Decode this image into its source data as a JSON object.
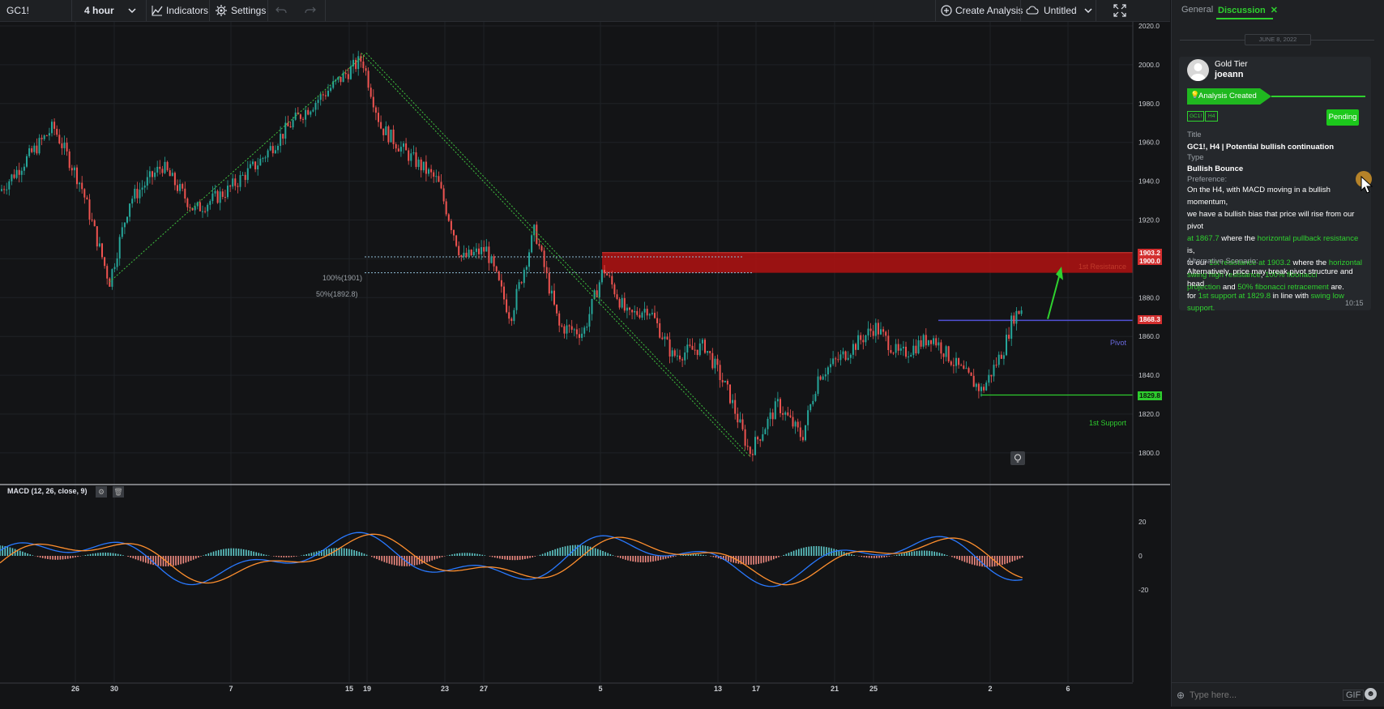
{
  "toolbar": {
    "symbol": "GC1!",
    "interval": "4 hour",
    "indicators_label": "Indicators",
    "settings_label": "Settings",
    "create_analysis_label": "Create Analysis",
    "layout_name": "Untitled"
  },
  "chart": {
    "price_labels": [
      "2020.0",
      "2000.0",
      "1980.0",
      "1960.0",
      "1940.0",
      "1920.0",
      "1900.0",
      "1880.0",
      "1860.0",
      "1840.0",
      "1820.0",
      "1800.0"
    ],
    "date_labels": [
      "26",
      "30",
      "7",
      "15",
      "19",
      "23",
      "27",
      "5",
      "13",
      "17",
      "21",
      "25",
      "2",
      "6"
    ],
    "resistance": {
      "label": "1st Resistance",
      "value": "1903.2",
      "value2": "1900.0"
    },
    "pivot": {
      "label": "Pivot",
      "value": "1868.3"
    },
    "support": {
      "label": "1st Support",
      "value": "1829.8"
    },
    "fib_100": "100%(1901)",
    "fib_50": "50%(1892.8)",
    "colors": {
      "up": "#26a69a",
      "down": "#ef5350",
      "resistance": "#b31212",
      "pivot": "#5151d6",
      "support": "#2ecc2e",
      "fib": "#3fbf3f"
    }
  },
  "macd": {
    "title": "MACD (12, 26, close, 9)",
    "scale_labels": [
      "20",
      "0",
      "-20"
    ]
  },
  "sidebar": {
    "tabs": [
      "General",
      "Discussion"
    ],
    "date_pill": "JUNE 8, 2022",
    "user_tier": "Gold Tier",
    "username": "joeann",
    "status_banner": "Analysis Created",
    "tags": [
      "GC1!",
      "H4"
    ],
    "pending_label": "Pending",
    "title_label": "Title",
    "title_value": "GC1!, H4 | Potential bullish continuation",
    "type_label": "Type",
    "type_value": "Bullish Bounce",
    "preference_label": "Preference:",
    "alt_label": "Alternative Scenario:",
    "time": "10:15",
    "chat_placeholder": "Type here...",
    "gif_label": "GIF"
  }
}
